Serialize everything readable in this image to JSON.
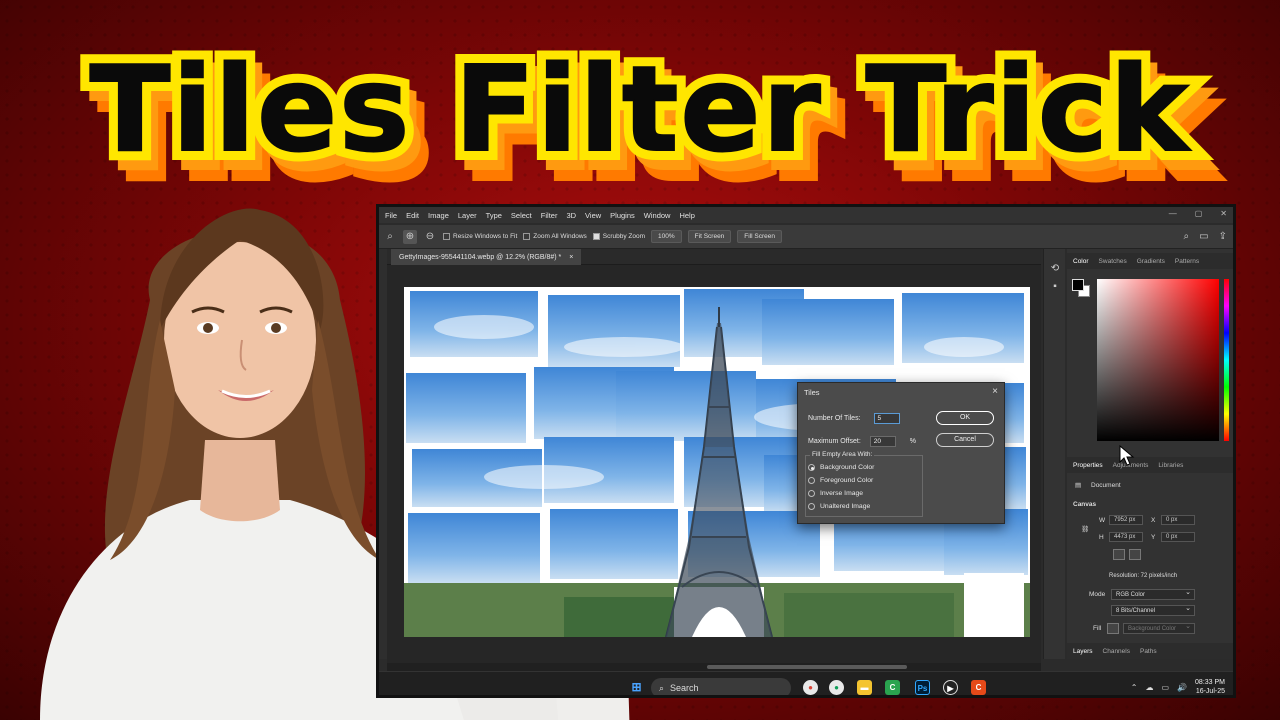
{
  "title": {
    "text": "Tiles Filter Trick"
  },
  "app": {
    "menu": [
      "File",
      "Edit",
      "Image",
      "Layer",
      "Type",
      "Select",
      "Filter",
      "3D",
      "View",
      "Plugins",
      "Window",
      "Help"
    ],
    "options_bar": {
      "resize_windows": "Resize Windows to Fit",
      "zoom_all": "Zoom All Windows",
      "scrubby_zoom": "Scrubby Zoom",
      "zoom_value": "100%",
      "fit_screen": "Fit Screen",
      "fill_screen": "Fill Screen"
    },
    "document_tab": "GettyImages-955441104.webp @ 12.2% (RGB/8#) *",
    "dialog": {
      "title": "Tiles",
      "number_of_tiles_label": "Number Of Tiles:",
      "number_of_tiles_value": "5",
      "max_offset_label": "Maximum Offset:",
      "max_offset_value": "20",
      "max_offset_unit": "%",
      "ok_label": "OK",
      "cancel_label": "Cancel",
      "fill_group_label": "Fill Empty Area With:",
      "fill_options": [
        "Background Color",
        "Foreground Color",
        "Inverse Image",
        "Unaltered Image"
      ],
      "selected_fill": "Background Color"
    },
    "color_panel": {
      "tabs": [
        "Color",
        "Swatches",
        "Gradients",
        "Patterns"
      ],
      "active_tab": "Color"
    },
    "properties_panel": {
      "tabs": [
        "Properties",
        "Adjustments",
        "Libraries"
      ],
      "document_label": "Document",
      "canvas_section": "Canvas",
      "width_label": "W",
      "width_value": "7952 px",
      "height_label": "H",
      "height_value": "4473 px",
      "x_label": "X",
      "x_value": "0 px",
      "y_label": "Y",
      "y_value": "0 px",
      "resolution": "Resolution: 72 pixels/inch",
      "mode_label": "Mode",
      "mode_value": "RGB Color",
      "depth_value": "8 Bits/Channel",
      "fill_label": "Fill",
      "fill_value": "Background Color"
    },
    "layers_panel": {
      "tabs": [
        "Layers",
        "Channels",
        "Paths"
      ]
    },
    "taskbar": {
      "search_label": "Search",
      "time": "08:33 PM",
      "date": "16-Jul-25"
    }
  },
  "colors": {
    "accent_yellow": "#ffe600",
    "accent_orange": "#ff7a00",
    "background_red": "#8b0000"
  }
}
